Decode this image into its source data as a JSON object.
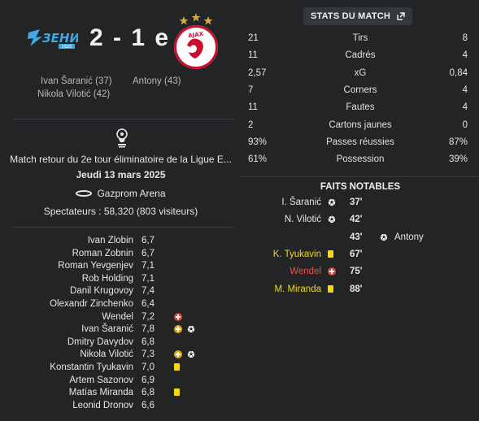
{
  "match": {
    "home_score": "2",
    "away_score": "1",
    "score_text": "2 - 1 e",
    "home_team_logo": "zenit-logo",
    "away_team_logo": "ajax-logo"
  },
  "scorers": {
    "home": [
      "Ivan Šaranić (37)",
      "Nikola Vilotić (42)"
    ],
    "away": [
      "Antony (43)"
    ]
  },
  "info": {
    "competition_icon": "uefa-europa-league-icon",
    "competition": "Match retour du 2e tour éliminatoire de la Ligue E...",
    "date": "Jeudi 13 mars 2025",
    "stadium": "Gazprom Arena",
    "attendance": "Spectateurs : 58,320 (803 visiteurs)"
  },
  "lineup": [
    {
      "name": "Ivan Zlobin",
      "rating": "6,7",
      "events": []
    },
    {
      "name": "Roman Zobnin",
      "rating": "6,7",
      "events": []
    },
    {
      "name": "Roman Yevgenjev",
      "rating": "7,1",
      "events": []
    },
    {
      "name": "Rob Holding",
      "rating": "7,1",
      "events": []
    },
    {
      "name": "Danil Krugovoy",
      "rating": "7,4",
      "events": []
    },
    {
      "name": "Olexandr Zinchenko",
      "rating": "6,4",
      "events": []
    },
    {
      "name": "Wendel",
      "rating": "7,2",
      "events": [
        "sub-off"
      ]
    },
    {
      "name": "Ivan Šaranić",
      "rating": "7,8",
      "events": [
        "sub-on",
        "goal"
      ]
    },
    {
      "name": "Dmitry Davydov",
      "rating": "6,8",
      "events": []
    },
    {
      "name": "Nikola Vilotić",
      "rating": "7,3",
      "events": [
        "sub-on",
        "goal"
      ]
    },
    {
      "name": "Konstantin Tyukavin",
      "rating": "7,0",
      "events": [
        "yellow-card"
      ]
    },
    {
      "name": "Artem Sazonov",
      "rating": "6,9",
      "events": []
    },
    {
      "name": "Matías Miranda",
      "rating": "6,8",
      "events": [
        "yellow-card"
      ]
    },
    {
      "name": "Leonid Dronov",
      "rating": "6,6",
      "events": []
    }
  ],
  "stats": {
    "button_label": "STATS DU MATCH",
    "rows": [
      {
        "label": "Tirs",
        "home": "21",
        "away": "8"
      },
      {
        "label": "Cadrés",
        "home": "11",
        "away": "4"
      },
      {
        "label": "xG",
        "home": "2,57",
        "away": "0,84"
      },
      {
        "label": "Corners",
        "home": "7",
        "away": "4"
      },
      {
        "label": "Fautes",
        "home": "11",
        "away": "4"
      },
      {
        "label": "Cartons jaunes",
        "home": "2",
        "away": "0"
      },
      {
        "label": "Passes réussies",
        "home": "93%",
        "away": "87%"
      },
      {
        "label": "Possession",
        "home": "61%",
        "away": "39%"
      }
    ]
  },
  "faits": {
    "title": "FAITS NOTABLES",
    "events": [
      {
        "side": "home",
        "player": "I. Šaranić",
        "minute": "37'",
        "type": "goal",
        "color": "#e6e6e6"
      },
      {
        "side": "home",
        "player": "N. Vilotić",
        "minute": "42'",
        "type": "goal",
        "color": "#e6e6e6"
      },
      {
        "side": "away",
        "player": "Antony",
        "minute": "43'",
        "type": "goal",
        "color": "#e6e6e6"
      },
      {
        "side": "home",
        "player": "K. Tyukavin",
        "minute": "67'",
        "type": "yellow-card",
        "color": "#f5d90a"
      },
      {
        "side": "home",
        "player": "Wendel",
        "minute": "75'",
        "type": "sub-off",
        "color": "#e5574b"
      },
      {
        "side": "home",
        "player": "M. Miranda",
        "minute": "88'",
        "type": "yellow-card",
        "color": "#f5d90a"
      }
    ]
  },
  "colors": {
    "background": "#222426",
    "yellow_card": "#f5d90a",
    "sub_off": "#d9483b",
    "sub_on": "#e8a317",
    "zenit_blue": "#3fa9e0"
  }
}
